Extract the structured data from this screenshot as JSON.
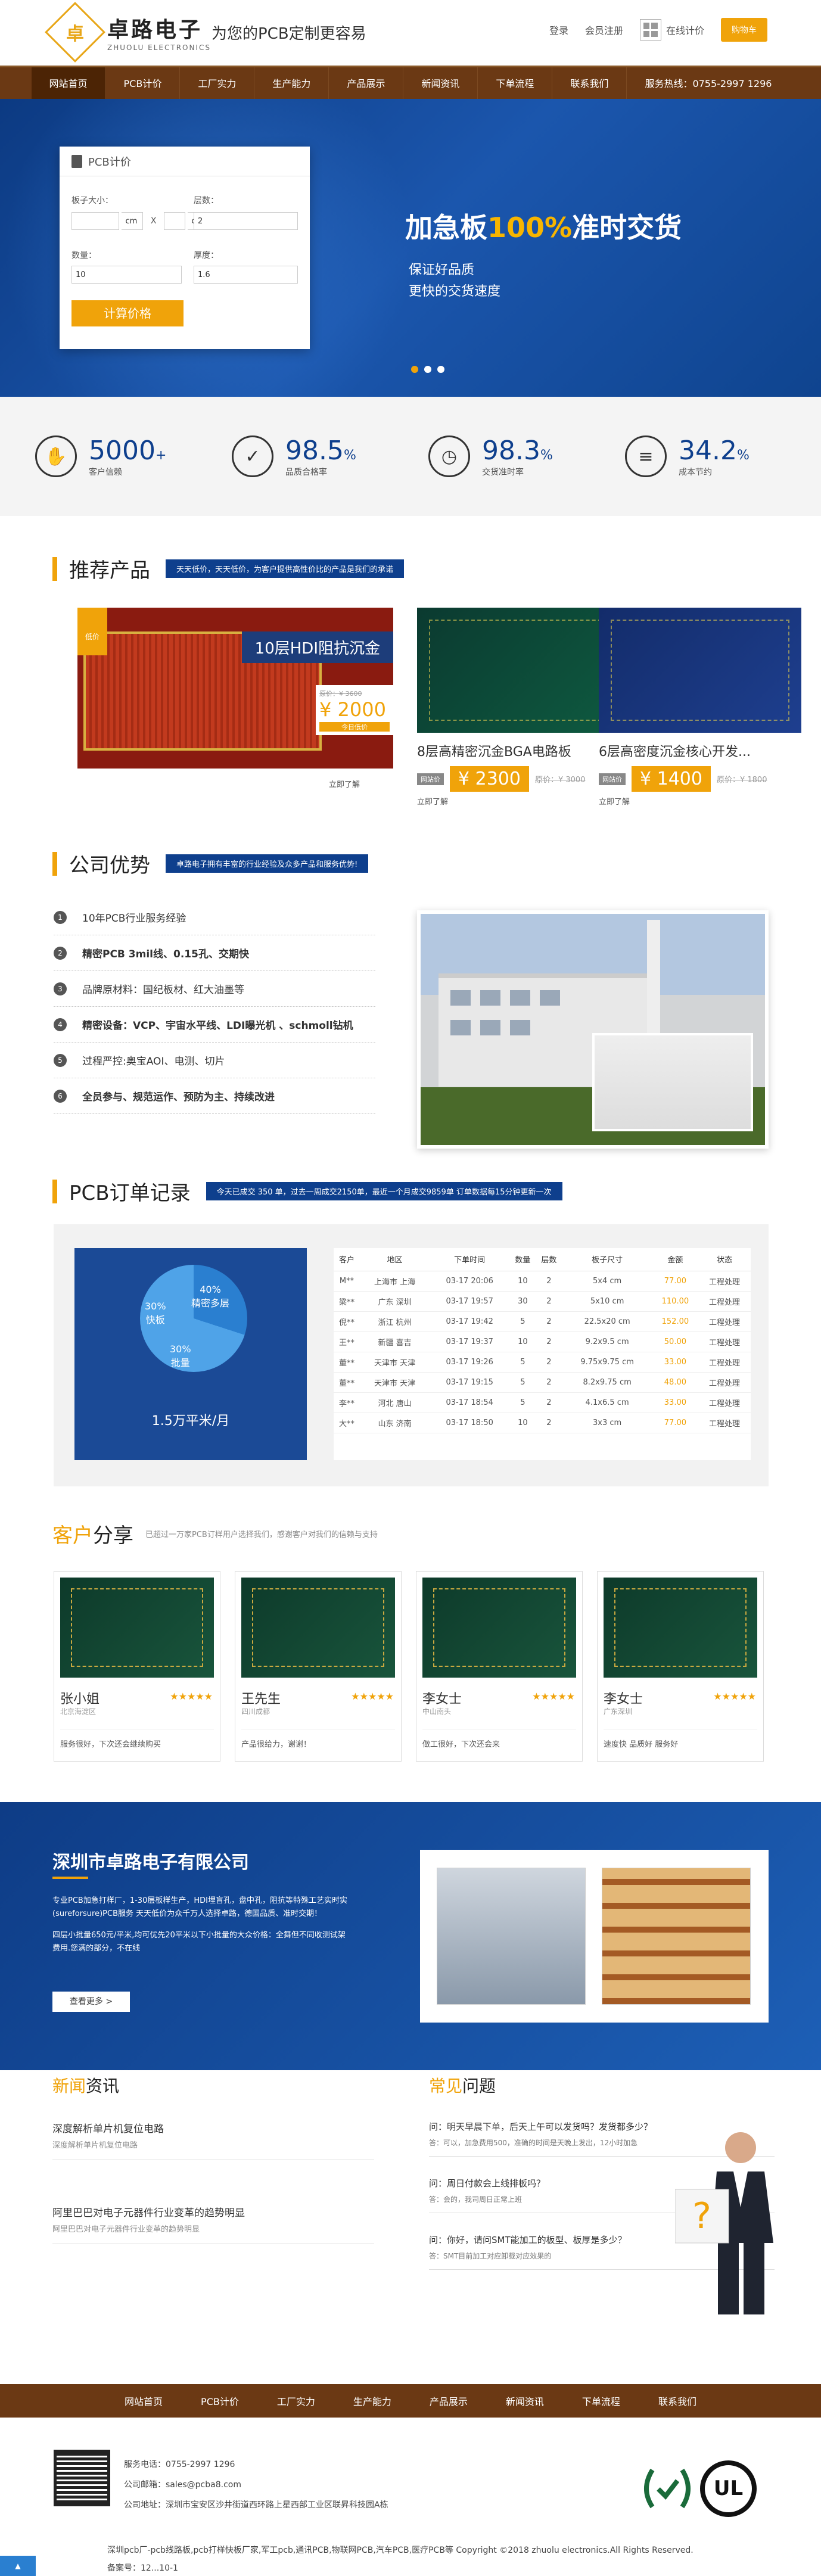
{
  "header": {
    "logo_char": "卓",
    "logo_cn": "卓路电子",
    "logo_en": "ZHUOLU ELECTRONICS",
    "slogan": "为您的PCB定制更容易",
    "login": "登录",
    "register": "会员注册",
    "online_quote": "在线计价",
    "buy": "购物车"
  },
  "nav": [
    "网站首页",
    "PCB计价",
    "工厂实力",
    "生产能力",
    "产品展示",
    "新闻资讯",
    "下单流程",
    "联系我们",
    "服务热线：0755-2997 1296"
  ],
  "calc": {
    "title": "PCB计价",
    "size_label": "板子大小：",
    "size_w_unit": "cm",
    "x": "X",
    "size_h_unit": "cm",
    "layers_label": "层数：",
    "layers_value": "2",
    "qty_label": "数量：",
    "qty_value": "10",
    "thick_label": "厚度：",
    "thick_value": "1.6",
    "button": "计算价格"
  },
  "banner": {
    "title_pre": "加急板",
    "title_hl": "100%",
    "title_post": "准时交货",
    "sub1": "保证好品质",
    "sub2": "更快的交货速度"
  },
  "stats": [
    {
      "icon": "handshake-icon",
      "glyph": "✋",
      "num": "5000",
      "unit": "+",
      "label": "客户信赖"
    },
    {
      "icon": "shield-icon",
      "glyph": "✓",
      "num": "98.5",
      "unit": "%",
      "label": "品质合格率"
    },
    {
      "icon": "clock-icon",
      "glyph": "◷",
      "num": "98.3",
      "unit": "%",
      "label": "交货准时率"
    },
    {
      "icon": "database-icon",
      "glyph": "≡",
      "num": "34.2",
      "unit": "%",
      "label": "成本节约"
    }
  ],
  "recommend": {
    "title": "推荐产品",
    "tag": "天天低价，天天低价，为客户提供高性价比的产品是我们的承诺",
    "featured": {
      "badge": "低价",
      "label": "10层HDI阻抗沉金",
      "old": "原价：¥ 3600",
      "price": "¥ 2000",
      "price_tag": "今日低价",
      "details": "立即了解"
    },
    "items": [
      {
        "name": "8层高精密沉金BGA电路板",
        "tag": "网站价",
        "price": "¥ 2300",
        "old": "原价：¥ 3000",
        "details": "立即了解"
      },
      {
        "name": "6层高密度沉金核心开发...",
        "tag": "网站价",
        "price": "¥ 1400",
        "old": "原价：¥ 1800",
        "details": "立即了解"
      }
    ]
  },
  "advantage": {
    "title": "公司优势",
    "tag": "卓路电子拥有丰富的行业经验及众多产品和服务优势!",
    "items": [
      {
        "n": "1",
        "text": "10年PCB行业服务经验",
        "bold": false
      },
      {
        "n": "2",
        "text": "精密PCB 3mil线、0.15孔、交期快",
        "bold": true
      },
      {
        "n": "3",
        "text": "品牌原材料：国纪板材、红大油墨等",
        "bold": false
      },
      {
        "n": "4",
        "text": "精密设备：VCP、宇宙水平线、LDI曝光机 、schmoll钻机",
        "bold": true
      },
      {
        "n": "5",
        "text": "过程严控:奥宝AOI、电测、切片",
        "bold": false
      },
      {
        "n": "6",
        "text": "全员参与、规范运作、预防为主、持续改进",
        "bold": true
      }
    ]
  },
  "orders": {
    "title": "PCB订单记录",
    "tag": "今天已成交 350 单，过去一周成交2150单，最近一个月成交9859单   订单数据每15分钟更新一次",
    "pie": {
      "a": "30%",
      "a_label": "快板",
      "b": "40%",
      "b_label": "精密多层",
      "c": "30%",
      "c_label": "批量",
      "footer": "1.5万平米/月"
    },
    "headers": [
      "客户",
      "地区",
      "下单时间",
      "数量",
      "层数",
      "板子尺寸",
      "金额",
      "状态"
    ],
    "rows": [
      [
        "M**",
        "上海市 上海",
        "03-17 20:06",
        "10",
        "2",
        "5x4 cm",
        "77.00",
        "工程处理"
      ],
      [
        "梁**",
        "广东 深圳",
        "03-17 19:57",
        "30",
        "2",
        "5x10 cm",
        "110.00",
        "工程处理"
      ],
      [
        "倪**",
        "浙江 杭州",
        "03-17 19:42",
        "5",
        "2",
        "22.5x20 cm",
        "152.00",
        "工程处理"
      ],
      [
        "王**",
        "新疆 喜吉",
        "03-17 19:37",
        "10",
        "2",
        "9.2x9.5 cm",
        "50.00",
        "工程处理"
      ],
      [
        "董**",
        "天津市 天津",
        "03-17 19:26",
        "5",
        "2",
        "9.75x9.75 cm",
        "33.00",
        "工程处理"
      ],
      [
        "董**",
        "天津市 天津",
        "03-17 19:15",
        "5",
        "2",
        "8.2x9.75 cm",
        "48.00",
        "工程处理"
      ],
      [
        "李**",
        "河北 唐山",
        "03-17 18:54",
        "5",
        "2",
        "4.1x6.5 cm",
        "33.00",
        "工程处理"
      ],
      [
        "大**",
        "山东 济南",
        "03-17 18:50",
        "10",
        "2",
        "3x3 cm",
        "77.00",
        "工程处理"
      ]
    ]
  },
  "customers": {
    "title_a": "客户",
    "title_b": "分享",
    "tag": "已超过一万家PCB订样用户选择我们，感谢客户对我们的信赖与支持",
    "items": [
      {
        "name": "张小姐",
        "loc": "北京海淀区",
        "stars": "★★★★★",
        "comment": "服务很好，下次还会继续购买"
      },
      {
        "name": "王先生",
        "loc": "四川成都",
        "stars": "★★★★★",
        "comment": "产品很给力，谢谢！"
      },
      {
        "name": "李女士",
        "loc": "中山南头",
        "stars": "★★★★★",
        "comment": "做工很好，下次还会来"
      },
      {
        "name": "李女士",
        "loc": "广东深圳",
        "stars": "★★★★★",
        "comment": "速度快 品质好 服务好"
      }
    ]
  },
  "company": {
    "title": "深圳市卓路电子有限公司",
    "text1": "专业PCB加急打样厂，1-30层板样生产，HDI埋盲孔，盘中孔，阻抗等特殊工艺实时实(sureforsure)PCB服务 天天低价为众千万人选择卓路，德国品质、准时交期！",
    "text2": "四层小批量650元/平米,均可优先20平米以下小批量的大众价格：全舞但不同收测试架费用.您满的部分，不在线",
    "more": "查看更多 >"
  },
  "news": {
    "title_a": "新闻",
    "title_b": "资讯",
    "items": [
      {
        "title": "深度解析单片机复位电路",
        "desc": "深度解析单片机复位电路"
      },
      {
        "title": "阿里巴巴对电子元器件行业变革的趋势明显",
        "desc": "阿里巴巴对电子元器件行业变革的趋势明显"
      }
    ]
  },
  "faq": {
    "title_a": "常见",
    "title_b": "问题",
    "items": [
      {
        "q": "问：明天早晨下单，后天上午可以发货吗？发货都多少？",
        "a": "答：可以，加急费用500，准确的时间是天晚上发出，12小时加急"
      },
      {
        "q": "问：周日付款会上线排板吗？",
        "a": "答：会的，我司周日正常上班"
      },
      {
        "q": "问：你好，请问SMT能加工的板型、板厚是多少？",
        "a": "答：SMT目前加工对应卸载对应效果的"
      }
    ]
  },
  "footer": {
    "nav": [
      "网站首页",
      "PCB计价",
      "工厂实力",
      "生产能力",
      "产品展示",
      "新闻资讯",
      "下单流程",
      "联系我们"
    ],
    "phone": "服务电话：0755-2997 1296",
    "email": "公司邮箱：sales@pcba8.com",
    "address": "公司地址：深圳市宝安区沙井街道西环路上星西部工业区联昇科技园A栋",
    "copyright": "深圳pcb厂-pcb线路板,pcb打样快板厂家,军工pcb,通讯PCB,物联网PCB,汽车PCB,医疗PCB等 Copyright ©2018 zhuolu electronics.All Rights Reserved.",
    "icp": "备案号：",
    "icp_num": "12...10-1",
    "cert2": "UL"
  },
  "colors": {
    "brand_brown": "#6b3914",
    "accent": "#f0a30a",
    "blue": "#0e3f8d"
  }
}
